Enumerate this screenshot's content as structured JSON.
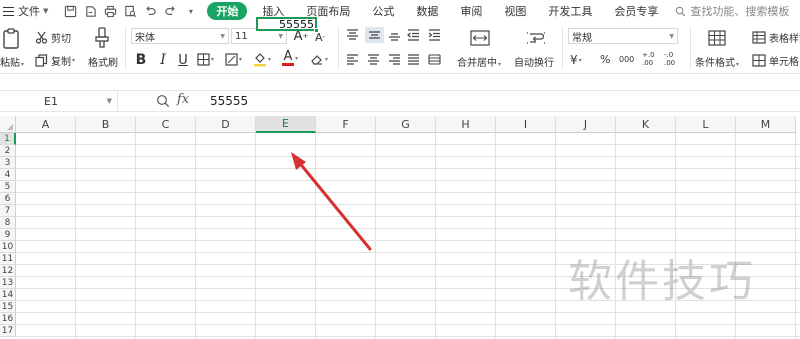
{
  "menubar": {
    "file_label": "文件",
    "tabs": [
      {
        "label": "开始",
        "active": true
      },
      {
        "label": "插入"
      },
      {
        "label": "页面布局"
      },
      {
        "label": "公式"
      },
      {
        "label": "数据"
      },
      {
        "label": "审阅"
      },
      {
        "label": "视图"
      },
      {
        "label": "开发工具"
      },
      {
        "label": "会员专享"
      }
    ],
    "search_placeholder": "查找功能、搜索模板"
  },
  "ribbon": {
    "paste_label": "粘贴",
    "cut_label": "剪切",
    "copy_label": "复制",
    "format_painter_label": "格式刷",
    "font_name": "宋体",
    "font_size": "11",
    "bold": "B",
    "italic": "I",
    "underline": "U",
    "font_color_letter": "A",
    "font_grow": "A",
    "font_shrink": "A",
    "merge_label": "合并居中",
    "wrap_label": "自动换行",
    "number_format": "常规",
    "currency_symbol": "¥",
    "percent_symbol": "%",
    "thousands_symbol": "000",
    "inc_decimal": "+.0 .00",
    "dec_decimal": "-.0 .00",
    "conditional_format_label": "条件格式",
    "table_style_label": "表格样式",
    "cell_style_label": "单元格"
  },
  "formula_bar": {
    "name_box": "E1",
    "fx_label": "fx",
    "content": "55555"
  },
  "sheet": {
    "columns": [
      "A",
      "B",
      "C",
      "D",
      "E",
      "F",
      "G",
      "H",
      "I",
      "J",
      "K",
      "L",
      "M"
    ],
    "rows": [
      "1",
      "2",
      "3",
      "4",
      "5",
      "6",
      "7",
      "8",
      "9",
      "10",
      "11",
      "12",
      "13",
      "14",
      "15",
      "16",
      "17"
    ],
    "selected_column": "E",
    "selected_row": "1",
    "active_cell_value": "55555"
  },
  "watermark": "软件技巧",
  "colors": {
    "accent": "#19a463",
    "selection": "#1f9a55",
    "annotation_arrow": "#d63232"
  }
}
